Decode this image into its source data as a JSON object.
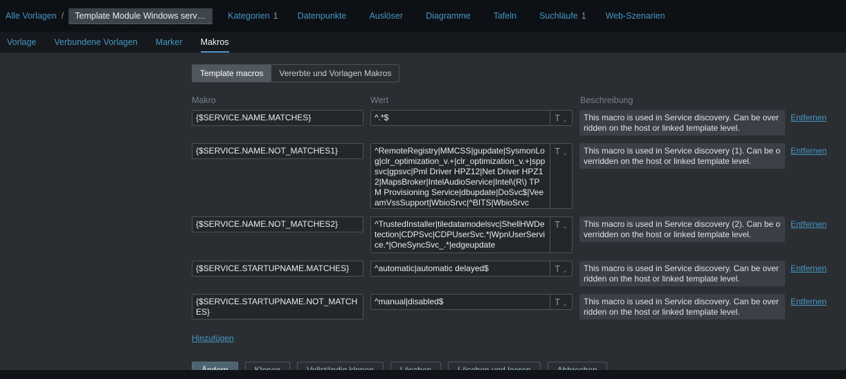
{
  "header": {
    "breadcrumb": {
      "all_templates": "Alle Vorlagen",
      "separator": "/",
      "template_name": "Template Module Windows servic..."
    },
    "tabs": [
      {
        "label": "Kategorien",
        "count": "1"
      },
      {
        "label": "Datenpunkte",
        "count": ""
      },
      {
        "label": "Auslöser",
        "count": ""
      },
      {
        "label": "Diagramme",
        "count": ""
      },
      {
        "label": "Tafeln",
        "count": ""
      },
      {
        "label": "Suchläufe",
        "count": "1"
      },
      {
        "label": "Web-Szenarien",
        "count": ""
      }
    ]
  },
  "subnav": {
    "items": [
      {
        "label": "Vorlage"
      },
      {
        "label": "Verbundene Vorlagen"
      },
      {
        "label": "Marker"
      },
      {
        "label": "Makros"
      }
    ]
  },
  "macros_section": {
    "view_toggle": [
      {
        "label": "Template macros",
        "selected": true
      },
      {
        "label": "Vererbte und Vorlagen Makros",
        "selected": false
      }
    ],
    "columns": [
      "Makro",
      "Wert",
      "Beschreibung"
    ],
    "type_button": "T",
    "remove_label": "Entfernen",
    "add_label": "Hinzufügen",
    "rows": [
      {
        "macro": "{$SERVICE.NAME.MATCHES}",
        "value": "^.*$",
        "description": "This macro is used in Service discovery. Can be overridden on the host or linked template level."
      },
      {
        "macro": "{$SERVICE.NAME.NOT_MATCHES1}",
        "value": "^RemoteRegistry|MMCSS|gupdate|SysmonLog|clr_optimization_v.+|clr_optimization_v.+|sppsvc|gpsvc|Pml Driver HPZ12|Net Driver HPZ12|MapsBroker|IntelAudioService|Intel\\(R\\) TPM Provisioning Service|dbupdate|DoSvc$|VeeamVssSupport|WbioSrvc|^BITS|WbioSrvc",
        "description": "This macro is used in Service discovery (1). Can be overridden on the host or linked template level."
      },
      {
        "macro": "{$SERVICE.NAME.NOT_MATCHES2}",
        "value": "^TrustedInstaller|tiledatamodelsvc|ShellHWDetection|CDPSvc|CDPUserSvc.*|WpnUserService.*|OneSyncSvc_.*|edgeupdate",
        "description": "This macro is used in Service discovery (2). Can be overridden on the host or linked template level."
      },
      {
        "macro": "{$SERVICE.STARTUPNAME.MATCHES}",
        "value": "^automatic|automatic delayed$",
        "description": "This macro is used in Service discovery. Can be overridden on the host or linked template level."
      },
      {
        "macro": "{$SERVICE.STARTUPNAME.NOT_MATCHES}",
        "value": "^manual|disabled$",
        "description": "This macro is used in Service discovery. Can be overridden on the host or linked template level."
      }
    ]
  },
  "footer_buttons": {
    "update": "Ändern",
    "clone": "Klonen",
    "full_clone": "Vollständig klonen",
    "delete": "Löschen",
    "delete_clear": "Löschen und leeren",
    "cancel": "Abbrechen"
  }
}
